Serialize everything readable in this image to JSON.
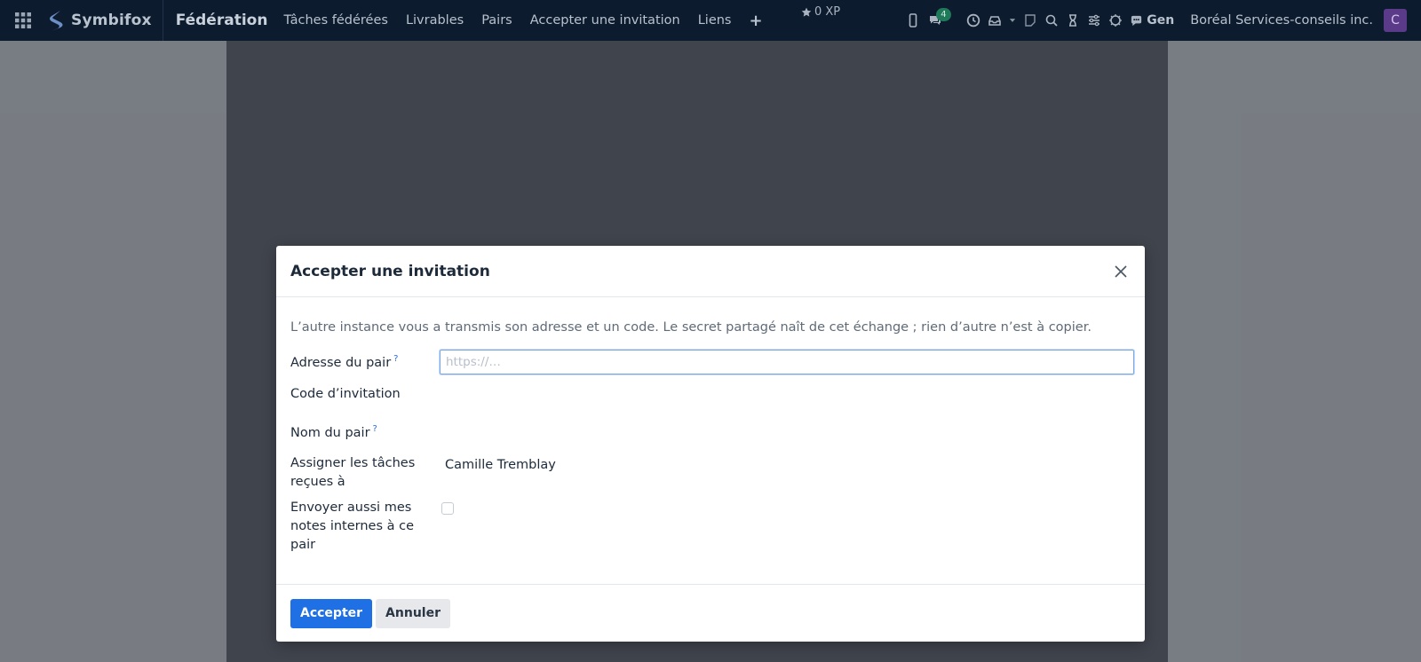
{
  "app": {
    "brand": "Symbifox",
    "module": "Fédération",
    "menu": [
      "Tâches fédérées",
      "Livrables",
      "Pairs",
      "Accepter une invitation",
      "Liens"
    ],
    "add_symbol": "+",
    "xp": "0 XP",
    "messages_count": "4",
    "gen_label": "Gen",
    "company": "Boréal Services-conseils inc.",
    "avatar_letter": "C"
  },
  "modal": {
    "title": "Accepter une invitation",
    "intro": "L’autre instance vous a transmis son adresse et un code. Le secret partagé naît de cet échange ; rien d’autre n’est à copier.",
    "fields": {
      "peer_address": {
        "label": "Adresse du pair",
        "help": "?",
        "value": "",
        "placeholder": "https://…"
      },
      "invitation_code": {
        "label": "Code d’invitation"
      },
      "peer_name": {
        "label": "Nom du pair",
        "help": "?"
      },
      "assign_to": {
        "label": "Assigner les tâches reçues à",
        "value": "Camille Tremblay"
      },
      "send_notes": {
        "label": "Envoyer aussi mes notes internes à ce pair",
        "checked": false
      }
    },
    "buttons": {
      "accept": "Accepter",
      "cancel": "Annuler"
    }
  },
  "colors": {
    "navbar": "#0d1b2e",
    "primary": "#1f6fe5",
    "avatar": "#5b3a8a",
    "badge": "#1f7a5a"
  }
}
